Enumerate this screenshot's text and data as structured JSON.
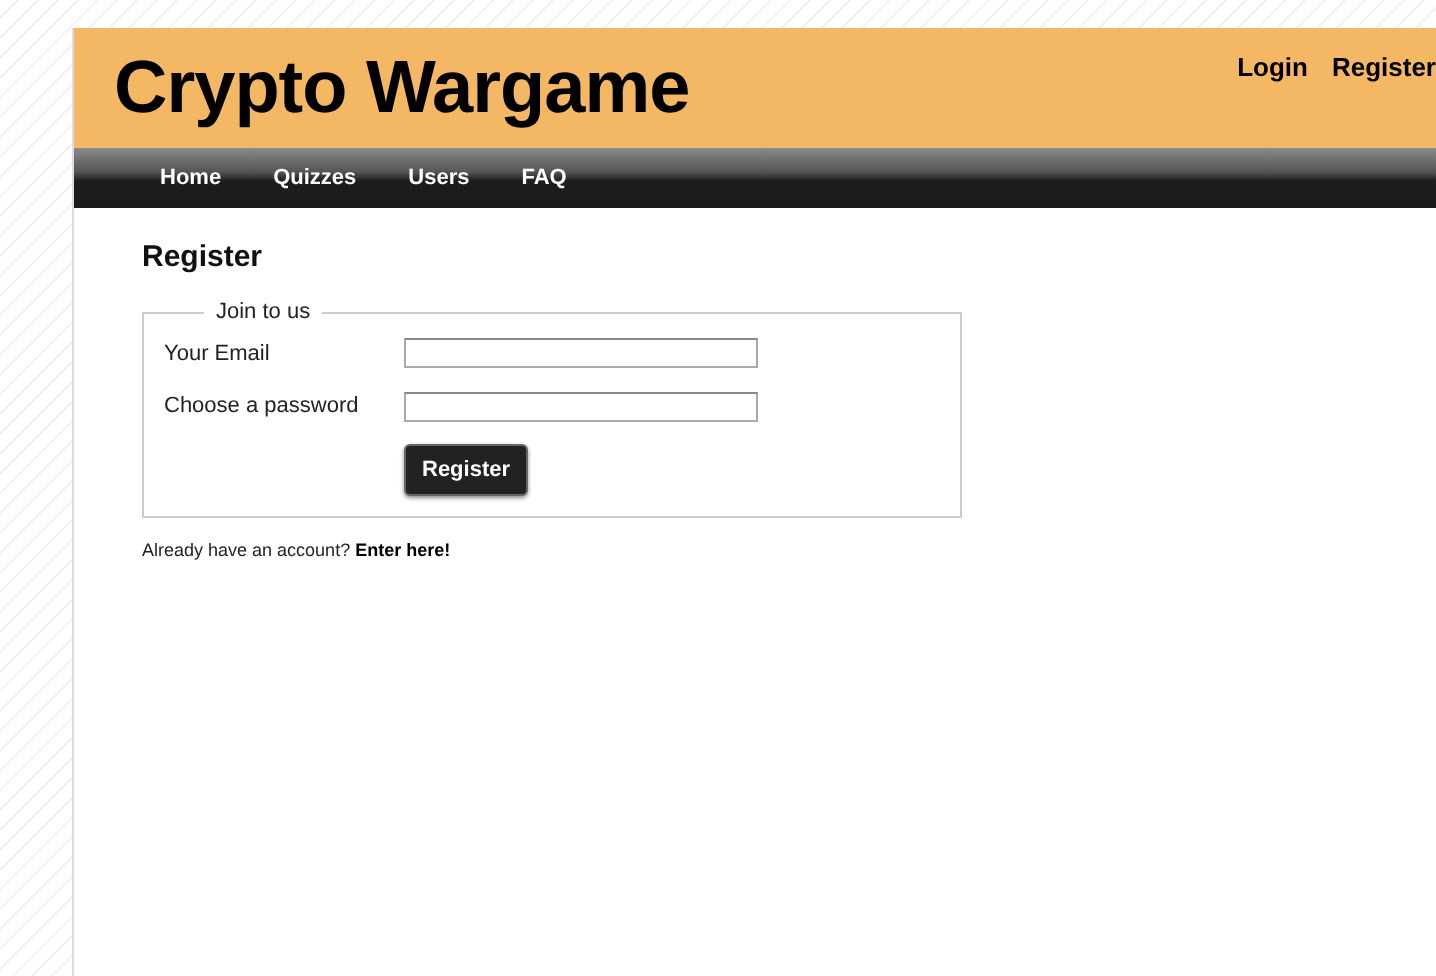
{
  "site_title": "Crypto Wargame",
  "account_links": [
    {
      "label": "Login"
    },
    {
      "label": "Register"
    }
  ],
  "nav": [
    {
      "label": "Home"
    },
    {
      "label": "Quizzes"
    },
    {
      "label": "Users"
    },
    {
      "label": "FAQ"
    }
  ],
  "page_heading": "Register",
  "form": {
    "legend": "Join to us",
    "fields": [
      {
        "label": "Your Email"
      },
      {
        "label": "Choose a password"
      }
    ],
    "submit": "Register"
  },
  "footer_note": {
    "text": "Already have an account?",
    "link": "Enter here!"
  }
}
